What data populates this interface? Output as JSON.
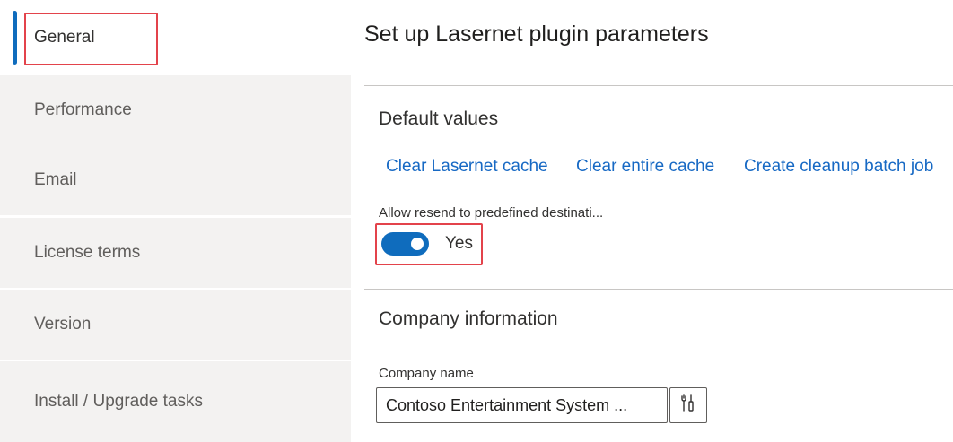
{
  "sidebar": {
    "items": [
      {
        "label": "General"
      },
      {
        "label": "Performance"
      },
      {
        "label": "Email"
      },
      {
        "label": "License terms"
      },
      {
        "label": "Version"
      },
      {
        "label": "Install / Upgrade tasks"
      }
    ],
    "active": "General"
  },
  "main": {
    "title": "Set up Lasernet plugin parameters",
    "default_values": {
      "heading": "Default values",
      "links": [
        "Clear Lasernet cache",
        "Clear entire cache",
        "Create cleanup batch job"
      ],
      "allow_resend_label": "Allow resend to predefined destinati...",
      "allow_resend_value": "Yes",
      "allow_resend_on": true
    },
    "company_info": {
      "heading": "Company information",
      "company_name_label": "Company name",
      "company_name_value": "Contoso Entertainment System ..."
    }
  },
  "colors": {
    "accent": "#0f6cbd",
    "link": "#1769c4",
    "callout": "#e3434b",
    "sidebar_bg": "#f3f2f1"
  },
  "icons": {
    "field_button": "tools-icon"
  }
}
